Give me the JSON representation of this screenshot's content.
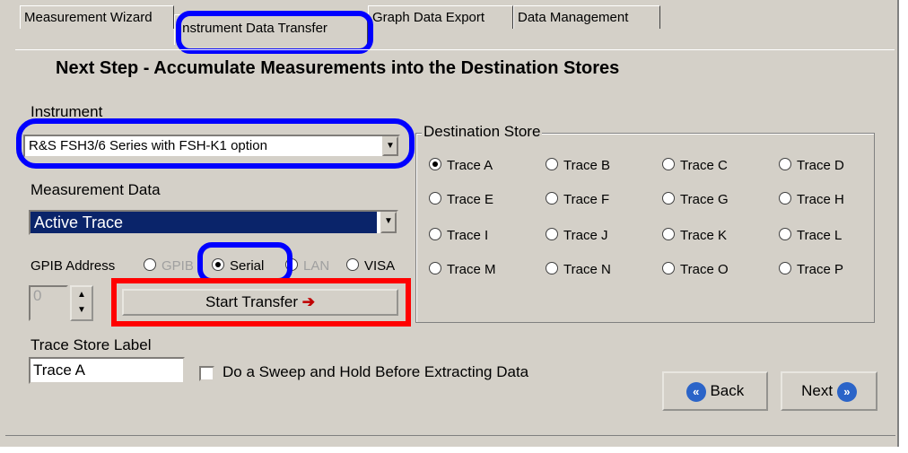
{
  "tabs": [
    "Measurement Wizard",
    "Instrument Data Transfer",
    "Graph Data Export",
    "Data Management"
  ],
  "heading": "Next Step - Accumulate Measurements into the Destination Stores",
  "instrument": {
    "label": "Instrument",
    "value": "R&S FSH3/6 Series with FSH-K1 option"
  },
  "measurement": {
    "label": "Measurement Data",
    "value": "Active Trace"
  },
  "interface": {
    "label": "GPIB Address",
    "options": [
      "GPIB",
      "Serial",
      "LAN",
      "VISA"
    ],
    "selected": "Serial"
  },
  "gpib_address": "0",
  "start_button": "Start Transfer",
  "destination": {
    "title": "Destination Store",
    "options": [
      "Trace A",
      "Trace B",
      "Trace C",
      "Trace D",
      "Trace E",
      "Trace F",
      "Trace G",
      "Trace H",
      "Trace I",
      "Trace J",
      "Trace K",
      "Trace L",
      "Trace M",
      "Trace N",
      "Trace O",
      "Trace P"
    ],
    "selected": "Trace A"
  },
  "trace_label": {
    "label": "Trace Store Label",
    "value": "Trace A"
  },
  "sweep_checkbox": "Do a Sweep and Hold Before Extracting Data",
  "back_button": "Back",
  "next_button": "Next"
}
